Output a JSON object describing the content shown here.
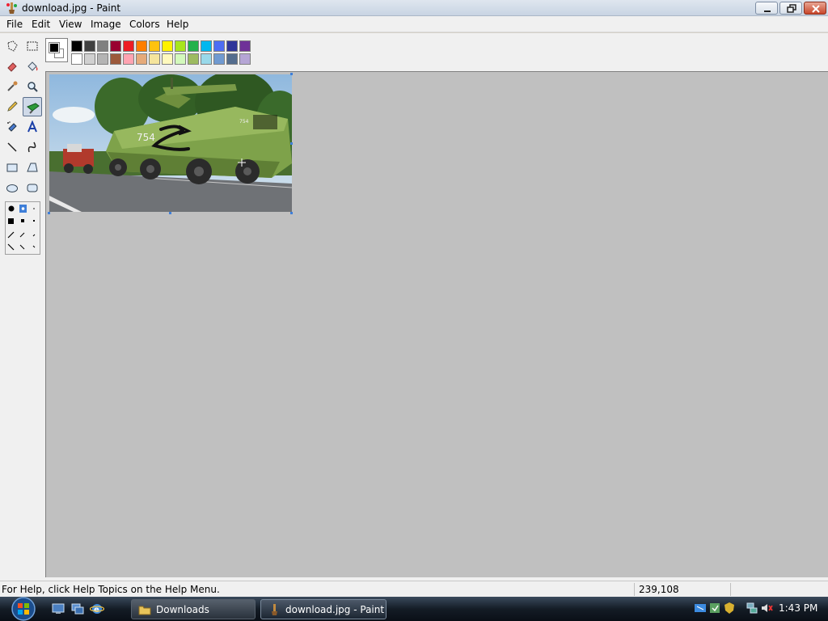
{
  "window": {
    "title": "download.jpg - Paint"
  },
  "menu": {
    "items": [
      "File",
      "Edit",
      "View",
      "Image",
      "Colors",
      "Help"
    ]
  },
  "palette": {
    "foreground": "#000000",
    "background": "#ffffff",
    "colors_top": [
      "#000000",
      "#404040",
      "#808080",
      "#990030",
      "#ed1c24",
      "#ff7e00",
      "#ffc20e",
      "#fff200",
      "#a8e61d",
      "#22b14c",
      "#00b7ef",
      "#4d6df3",
      "#2f3699",
      "#6f3198"
    ],
    "colors_bottom": [
      "#ffffff",
      "#d0d0d0",
      "#b4b4b4",
      "#9c5a3c",
      "#ffa3b1",
      "#e5aa7a",
      "#f5e49c",
      "#fff9bd",
      "#d3f9bc",
      "#9dbb61",
      "#99d9ea",
      "#709ad1",
      "#546d8e",
      "#b5a5d5"
    ]
  },
  "tools": [
    "free-form-select",
    "select",
    "eraser",
    "fill",
    "pick-color",
    "magnifier",
    "pencil",
    "brush",
    "airbrush",
    "text",
    "line",
    "curve",
    "rectangle",
    "polygon",
    "ellipse",
    "rounded-rectangle"
  ],
  "active_tool": "brush",
  "status": {
    "help": "For Help, click Help Topics on the Help Menu.",
    "coords": "239,108"
  },
  "taskbar": {
    "buttons": [
      {
        "label": "Downloads",
        "icon": "folder-icon"
      },
      {
        "label": "download.jpg - Paint",
        "icon": "paint-icon"
      }
    ],
    "clock": "1:43 PM"
  },
  "image": {
    "caption_number": "754"
  }
}
